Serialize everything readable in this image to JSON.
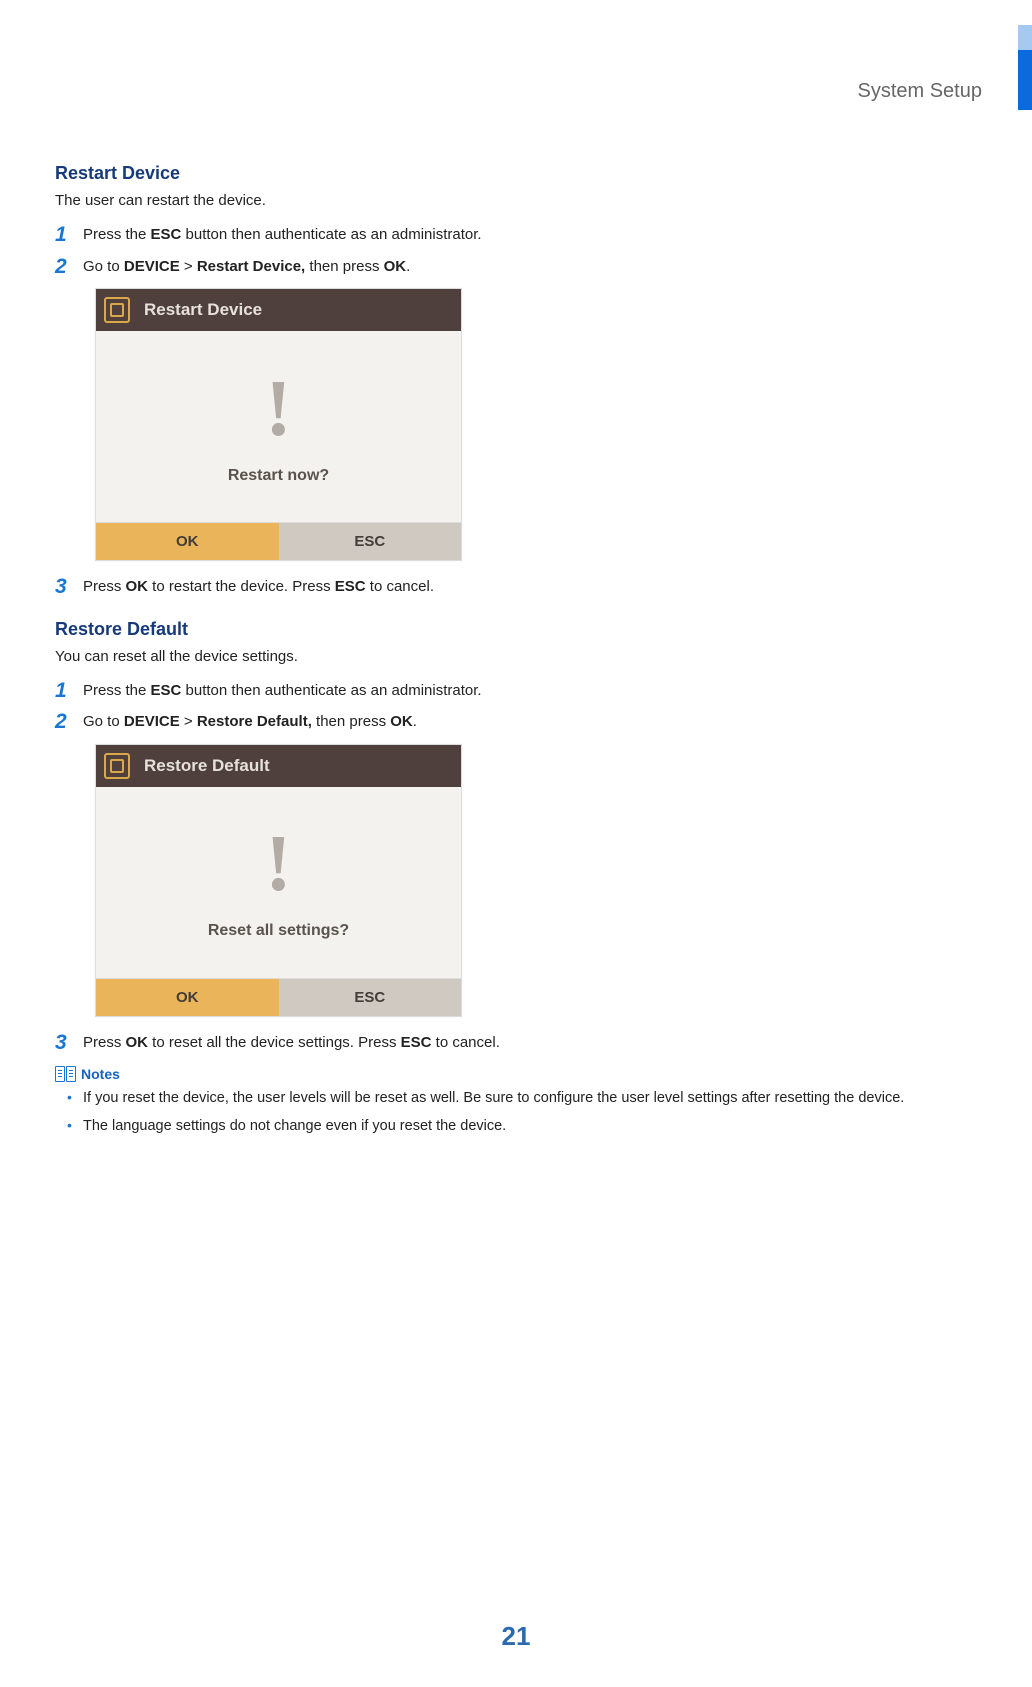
{
  "header": {
    "section_title": "System Setup"
  },
  "sections": {
    "restart": {
      "title": "Restart Device",
      "desc": "The user can restart the device.",
      "steps": {
        "s1": {
          "num": "1",
          "prefix": "Press the ",
          "bold1": "ESC",
          "suffix": " button then authenticate as an administrator."
        },
        "s2": {
          "num": "2",
          "prefix": "Go to ",
          "bold1": "DEVICE",
          "gt": " > ",
          "bold2": "Restart Device,",
          "mid": " then press ",
          "bold3": "OK",
          "end": "."
        },
        "s3": {
          "num": "3",
          "prefix": "Press ",
          "bold1": "OK",
          "mid": " to restart the device. Press ",
          "bold2": "ESC",
          "end": " to cancel."
        }
      },
      "device": {
        "title": "Restart Device",
        "prompt": "Restart now?",
        "ok": "OK",
        "esc": "ESC"
      }
    },
    "restore": {
      "title": "Restore Default",
      "desc": "You can reset all the device settings.",
      "steps": {
        "s1": {
          "num": "1",
          "prefix": "Press the ",
          "bold1": "ESC",
          "suffix": " button then authenticate as an administrator."
        },
        "s2": {
          "num": "2",
          "prefix": "Go to ",
          "bold1": "DEVICE",
          "gt": " > ",
          "bold2": "Restore Default,",
          "mid": " then press ",
          "bold3": "OK",
          "end": "."
        },
        "s3": {
          "num": "3",
          "prefix": "Press ",
          "bold1": "OK",
          "mid": " to reset all the device settings. Press ",
          "bold2": "ESC",
          "end": " to cancel."
        }
      },
      "device": {
        "title": "Restore Default",
        "prompt": "Reset all settings?",
        "ok": "OK",
        "esc": "ESC"
      }
    }
  },
  "notes": {
    "label": "Notes",
    "items": {
      "n1": "If you reset the device, the user levels will be reset as well. Be sure to configure the user level settings after resetting the device.",
      "n2": "The language settings do not change even if you reset the device."
    }
  },
  "page_number": "21"
}
